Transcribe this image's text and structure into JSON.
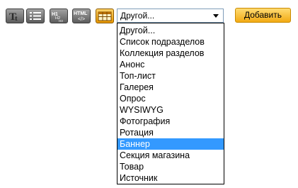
{
  "toolbar": {
    "buttons": [
      {
        "name": "text-format-icon",
        "label": "Tt"
      },
      {
        "name": "list-icon",
        "label": ""
      },
      {
        "name": "headings-icon",
        "label": "H1 H2 H3"
      },
      {
        "name": "html-icon",
        "label": "HTML"
      },
      {
        "name": "table-icon",
        "label": ""
      }
    ]
  },
  "select": {
    "value": "Другой...",
    "options": [
      "Другой...",
      "Список подразделов",
      "Коллекция разделов",
      "Анонс",
      "Топ-лист",
      "Галерея",
      "Опрос",
      "WYSIWYG",
      "Фотография",
      "Ротация",
      "Баннер",
      "Секция магазина",
      "Товар",
      "Источник"
    ],
    "highlighted": "Баннер"
  },
  "add_button": {
    "label": "Добавить"
  },
  "colors": {
    "highlight": "#3399ff",
    "add_button": "#f2aa14",
    "toolbar_button": "#7a7a7a",
    "active_button": "#f0a000"
  }
}
